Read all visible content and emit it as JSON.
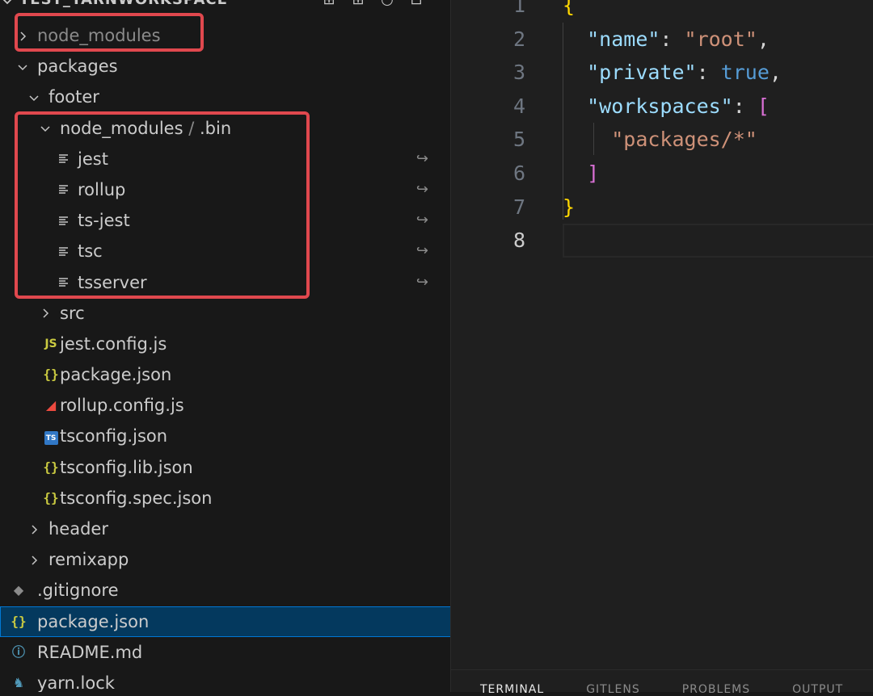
{
  "explorer": {
    "title": "TEST_YARNWORKSPACE",
    "actions": [
      {
        "icon": "new-file-icon",
        "glyph": "⊞"
      },
      {
        "icon": "new-folder-icon",
        "glyph": "⊞"
      },
      {
        "icon": "refresh-icon",
        "glyph": "○"
      },
      {
        "icon": "collapse-all-icon",
        "glyph": "⊟"
      }
    ]
  },
  "tree": [
    {
      "label": "node_modules",
      "depth": 0,
      "type": "folder",
      "expanded": false,
      "dim": true
    },
    {
      "label": "packages",
      "depth": 0,
      "type": "folder",
      "expanded": true
    },
    {
      "label": "footer",
      "depth": 1,
      "type": "folder",
      "expanded": true
    },
    {
      "label": "node_modules",
      "label_suffix": ".bin",
      "depth": 2,
      "type": "folder",
      "expanded": true,
      "dim_suffix": true
    },
    {
      "label": "jest",
      "depth": 3,
      "type": "symlink",
      "icon": "file-lines-icon"
    },
    {
      "label": "rollup",
      "depth": 3,
      "type": "symlink",
      "icon": "file-lines-icon"
    },
    {
      "label": "ts-jest",
      "depth": 3,
      "type": "symlink",
      "icon": "file-lines-icon"
    },
    {
      "label": "tsc",
      "depth": 3,
      "type": "symlink",
      "icon": "file-lines-icon"
    },
    {
      "label": "tsserver",
      "depth": 3,
      "type": "symlink",
      "icon": "file-lines-icon"
    },
    {
      "label": "src",
      "depth": 2,
      "type": "folder",
      "expanded": false
    },
    {
      "label": "jest.config.js",
      "depth": 2,
      "type": "file",
      "icon": "javascript-icon",
      "glyph": "JS"
    },
    {
      "label": "package.json",
      "depth": 2,
      "type": "file",
      "icon": "json-icon",
      "glyph": "{}"
    },
    {
      "label": "rollup.config.js",
      "depth": 2,
      "type": "file",
      "icon": "rollup-icon",
      "glyph": "◢"
    },
    {
      "label": "tsconfig.json",
      "depth": 2,
      "type": "file",
      "icon": "typescript-icon",
      "glyph": "TS"
    },
    {
      "label": "tsconfig.lib.json",
      "depth": 2,
      "type": "file",
      "icon": "json-icon",
      "glyph": "{}"
    },
    {
      "label": "tsconfig.spec.json",
      "depth": 2,
      "type": "file",
      "icon": "json-icon",
      "glyph": "{}"
    },
    {
      "label": "header",
      "depth": 1,
      "type": "folder",
      "expanded": false
    },
    {
      "label": "remixapp",
      "depth": 1,
      "type": "folder",
      "expanded": false
    },
    {
      "label": ".gitignore",
      "depth": 0,
      "type": "file",
      "icon": "git-icon",
      "glyph": "◆"
    },
    {
      "label": "package.json",
      "depth": 0,
      "type": "file",
      "icon": "json-icon",
      "glyph": "{}",
      "selected": true
    },
    {
      "label": "README.md",
      "depth": 0,
      "type": "file",
      "icon": "info-icon",
      "glyph": "ⓘ"
    },
    {
      "label": "yarn.lock",
      "depth": 0,
      "type": "file",
      "icon": "yarn-icon",
      "glyph": "♞"
    }
  ],
  "symlink_glyph": "↪",
  "editor": {
    "line_numbers": [
      "1",
      "2",
      "3",
      "4",
      "5",
      "6",
      "7",
      "8"
    ],
    "active_line": "8",
    "lines": [
      [
        {
          "t": "{",
          "c": "t-brace"
        }
      ],
      [
        {
          "t": "  "
        },
        {
          "t": "\"name\"",
          "c": "t-key"
        },
        {
          "t": ": ",
          "c": "t-punc"
        },
        {
          "t": "\"root\"",
          "c": "t-str"
        },
        {
          "t": ",",
          "c": "t-punc"
        }
      ],
      [
        {
          "t": "  "
        },
        {
          "t": "\"private\"",
          "c": "t-key"
        },
        {
          "t": ": ",
          "c": "t-punc"
        },
        {
          "t": "true",
          "c": "t-bool"
        },
        {
          "t": ",",
          "c": "t-punc"
        }
      ],
      [
        {
          "t": "  "
        },
        {
          "t": "\"workspaces\"",
          "c": "t-key"
        },
        {
          "t": ": ",
          "c": "t-punc"
        },
        {
          "t": "[",
          "c": "t-bracket"
        }
      ],
      [
        {
          "t": "    "
        },
        {
          "t": "\"packages/*\"",
          "c": "t-str"
        }
      ],
      [
        {
          "t": "  "
        },
        {
          "t": "]",
          "c": "t-bracket"
        }
      ],
      [
        {
          "t": "}",
          "c": "t-brace"
        }
      ],
      [
        {
          "t": ""
        }
      ]
    ]
  },
  "panel": {
    "tabs": [
      {
        "label": "TERMINAL",
        "active": true
      },
      {
        "label": "GITLENS",
        "active": false
      },
      {
        "label": "PROBLEMS",
        "active": false
      },
      {
        "label": "OUTPUT",
        "active": false
      }
    ]
  },
  "colors": {
    "highlight_box": "#e0484e",
    "selection_bg": "#04395e",
    "selection_border": "#0078d4"
  }
}
